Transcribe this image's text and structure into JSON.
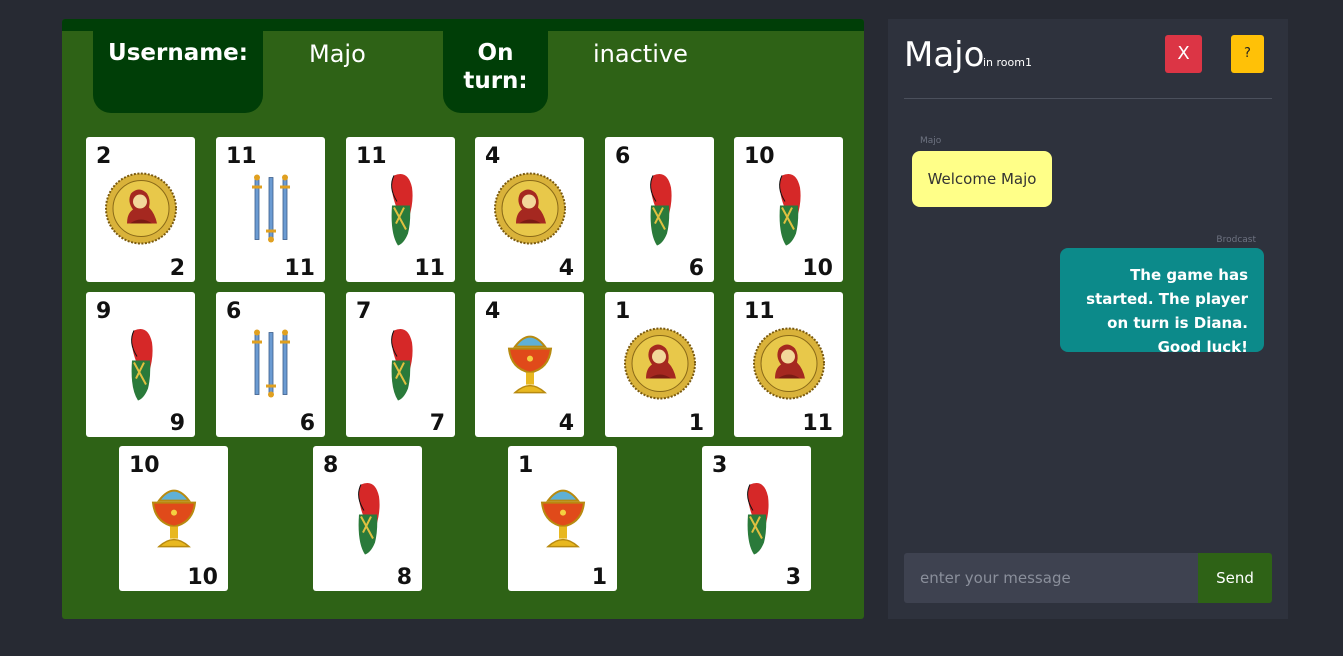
{
  "header": {
    "username_label": "Username:",
    "username_value": "Majo",
    "turn_label": "On turn:",
    "turn_value": "inactive"
  },
  "cards": [
    {
      "value": "2",
      "suit": "coins"
    },
    {
      "value": "11",
      "suit": "swords"
    },
    {
      "value": "11",
      "suit": "clubs"
    },
    {
      "value": "4",
      "suit": "coins"
    },
    {
      "value": "6",
      "suit": "clubs"
    },
    {
      "value": "10",
      "suit": "clubs"
    },
    {
      "value": "9",
      "suit": "clubs"
    },
    {
      "value": "6",
      "suit": "swords"
    },
    {
      "value": "7",
      "suit": "clubs"
    },
    {
      "value": "4",
      "suit": "cups"
    },
    {
      "value": "1",
      "suit": "coins"
    },
    {
      "value": "11",
      "suit": "coins"
    },
    {
      "value": "10",
      "suit": "cups"
    },
    {
      "value": "8",
      "suit": "clubs"
    },
    {
      "value": "1",
      "suit": "cups"
    },
    {
      "value": "3",
      "suit": "clubs"
    }
  ],
  "chat": {
    "title": "Majo",
    "room": "in room1",
    "close_label": "X",
    "help_label": "?",
    "messages": [
      {
        "sender": "Majo",
        "text": "Welcome Majo"
      },
      {
        "sender": "Brodcast",
        "text": "The game has started. The player on turn is Diana. Good luck!"
      }
    ],
    "input_placeholder": "enter your message",
    "send_label": "Send"
  },
  "colors": {
    "board": "#2e6216",
    "board_dark": "#003e07",
    "chat_bg": "#2e323d",
    "close": "#dc3545",
    "help": "#ffc107",
    "msg_user": "#ffff88",
    "msg_broadcast": "#0c8a8a"
  }
}
